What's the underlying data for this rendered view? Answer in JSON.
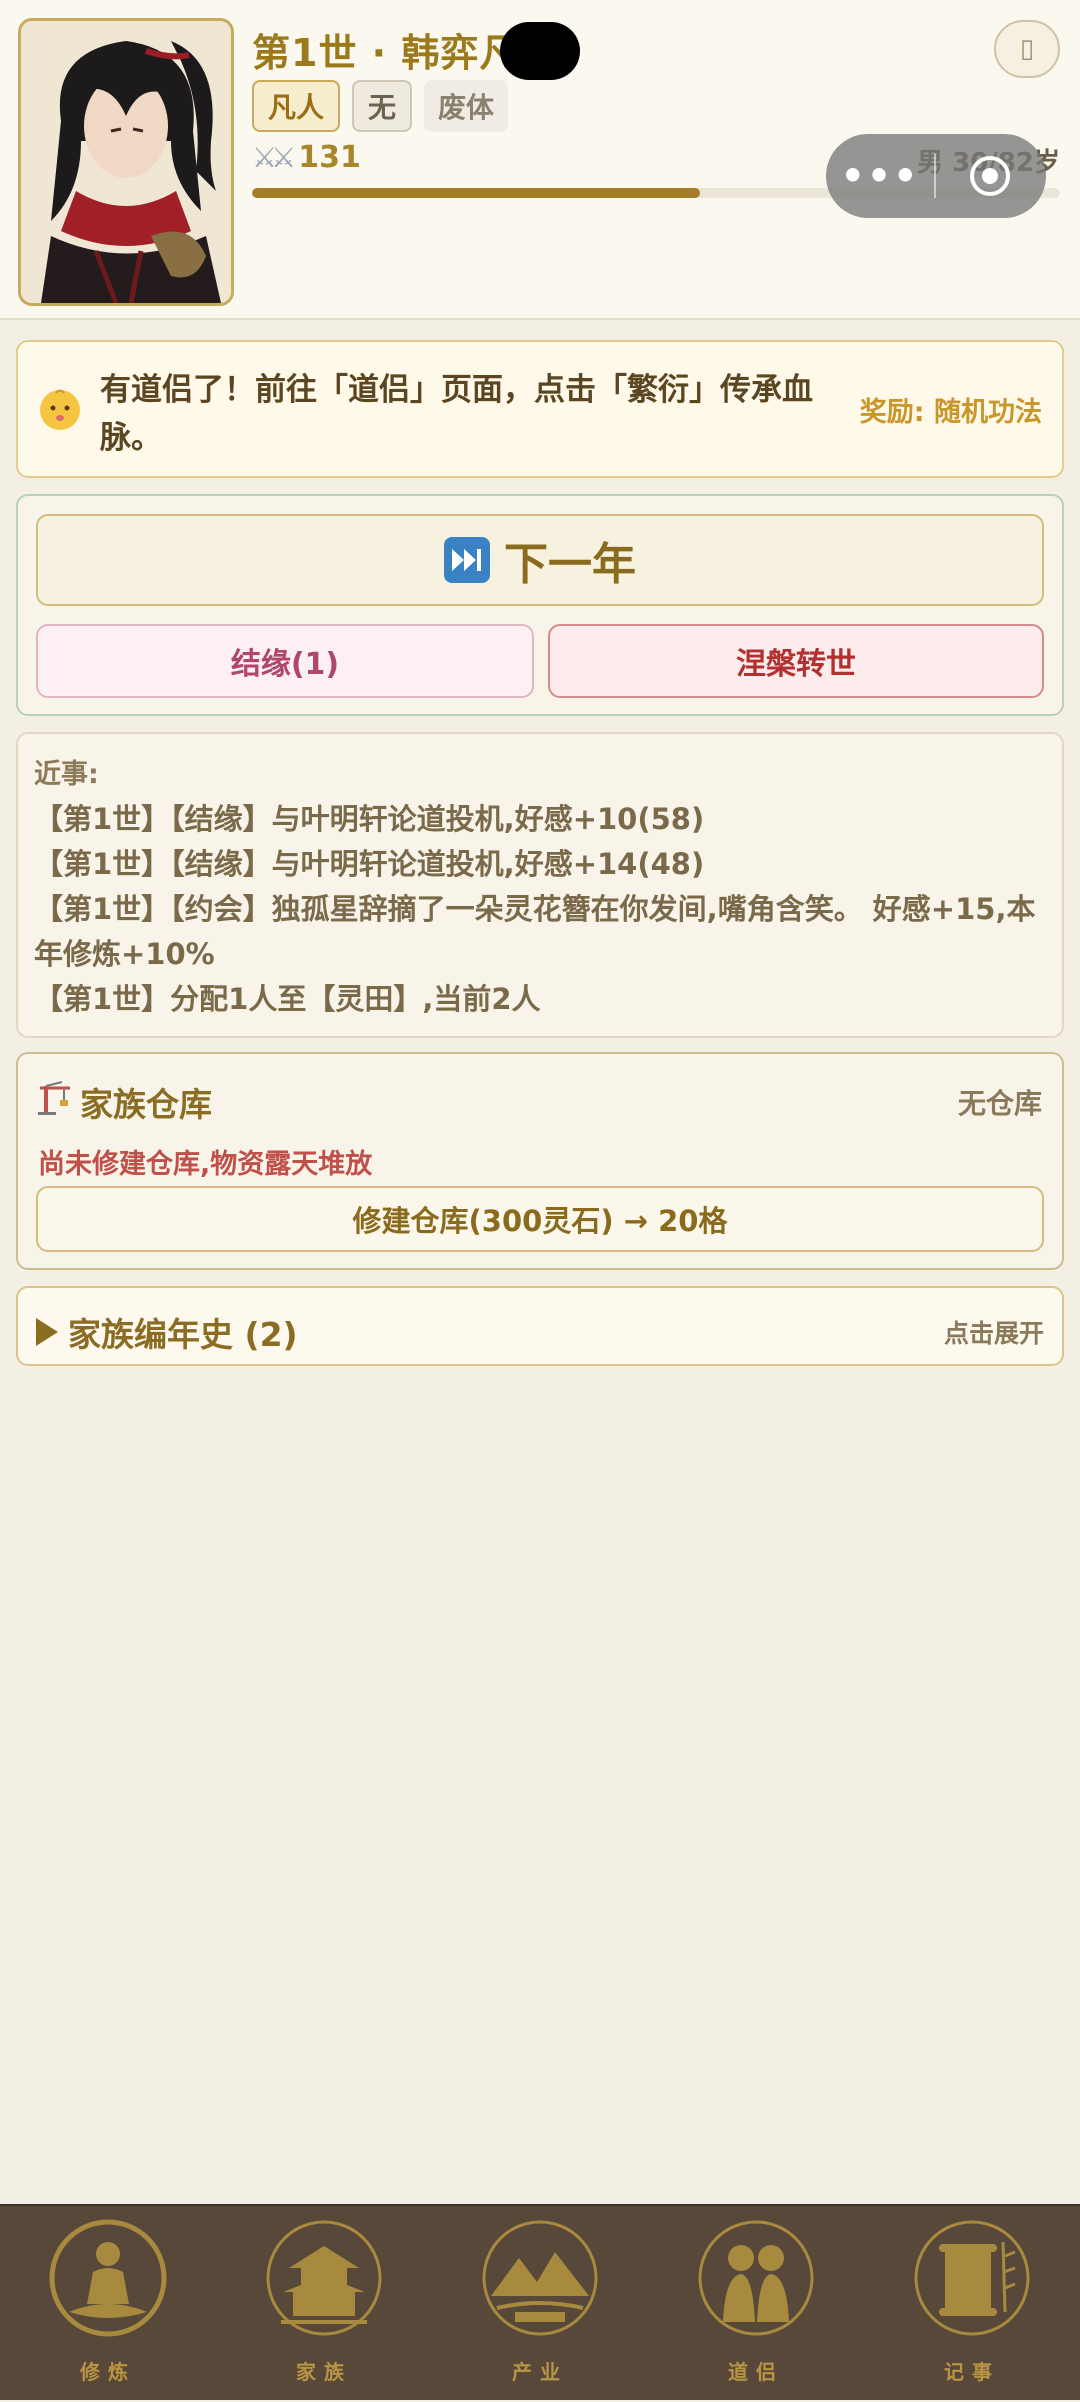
{
  "header": {
    "title": "第1世 · 韩弈凡",
    "tags": {
      "realm": "凡人",
      "root": "无",
      "body": "废体"
    },
    "power": "131",
    "age": "男 30/82岁",
    "life_progress": 0.555,
    "menu_more": "•••",
    "corner_button": "▯"
  },
  "notice": {
    "text": "有道侣了！前往「道侣」页面，点击「繁衍」传承血脉。",
    "reward": "奖励: 随机功法"
  },
  "actions": {
    "next_year": "下一年",
    "bond": "结缘(1)",
    "reborn": "涅槃转世"
  },
  "events": {
    "title": "近事:",
    "lines": [
      "【第1世】【结缘】与叶明轩论道投机,好感+10(58)",
      "【第1世】【结缘】与叶明轩论道投机,好感+14(48)",
      "【第1世】【约会】独孤星辞摘了一朵灵花簪在你发间,嘴角含笑。 好感+15,本年修炼+10%",
      "【第1世】分配1人至【灵田】,当前2人"
    ]
  },
  "warehouse": {
    "title": "家族仓库",
    "status": "无仓库",
    "note": "尚未修建仓库,物资露天堆放",
    "build_button": "修建仓库(300灵石) → 20格"
  },
  "chronicle": {
    "title": "家族编年史 (2)",
    "expand": "点击展开"
  },
  "nav": {
    "items": [
      {
        "label": "修炼",
        "icon": "meditation-icon"
      },
      {
        "label": "家族",
        "icon": "pavilion-icon"
      },
      {
        "label": "产业",
        "icon": "mountain-icon"
      },
      {
        "label": "道侣",
        "icon": "couple-icon"
      },
      {
        "label": "记事",
        "icon": "scroll-icon"
      }
    ]
  },
  "colors": {
    "accent_gold": "#9b7a1c",
    "nav_bg": "#57483a",
    "danger_red": "#b23030",
    "bond_pink": "#b0466a"
  }
}
